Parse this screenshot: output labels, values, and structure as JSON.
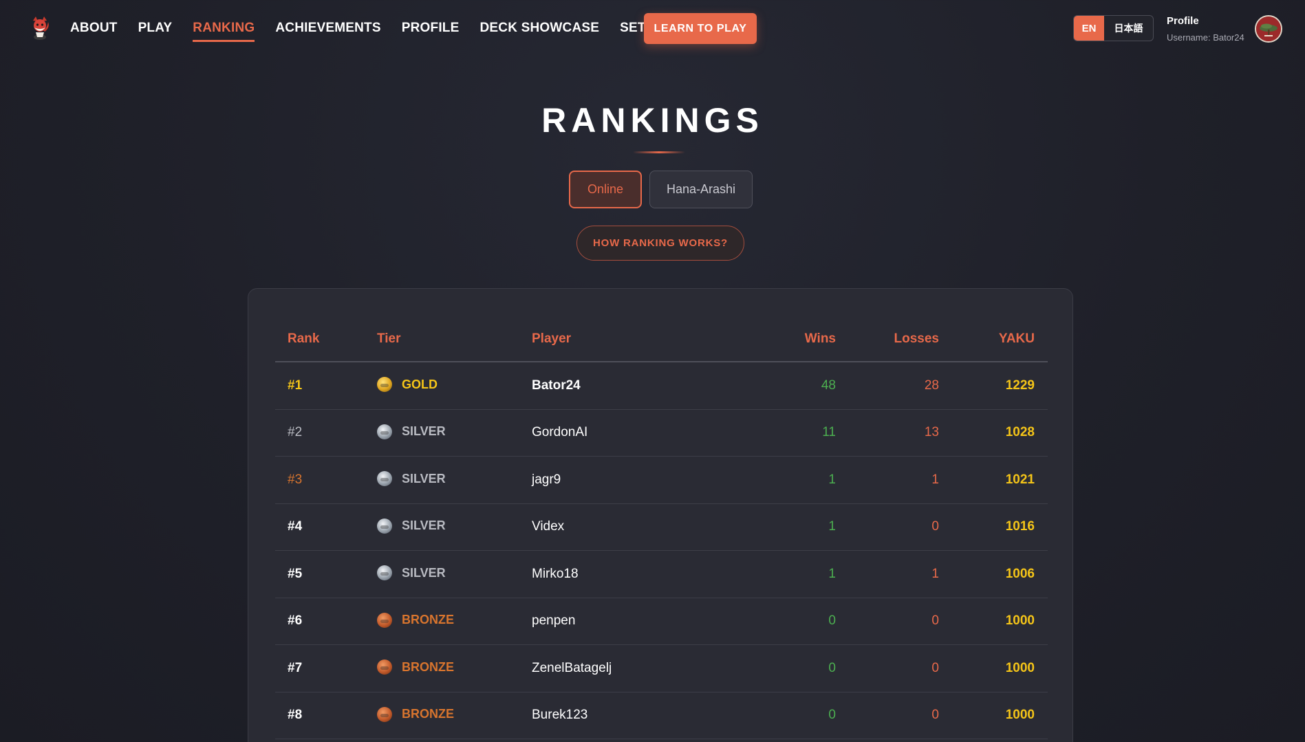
{
  "nav": {
    "links": [
      {
        "label": "ABOUT",
        "active": false
      },
      {
        "label": "PLAY",
        "active": false
      },
      {
        "label": "RANKING",
        "active": true
      },
      {
        "label": "ACHIEVEMENTS",
        "active": false
      },
      {
        "label": "PROFILE",
        "active": false
      },
      {
        "label": "DECK SHOWCASE",
        "active": false
      },
      {
        "label": "SETTINGS",
        "active": false
      }
    ],
    "cta_label": "LEARN TO PLAY",
    "lang_en": "EN",
    "lang_jp": "日本語",
    "profile_title": "Profile",
    "profile_username": "Username: Bator24"
  },
  "page": {
    "title": "RANKINGS",
    "tabs": [
      {
        "label": "Online",
        "selected": true
      },
      {
        "label": "Hana-Arashi",
        "selected": false
      }
    ],
    "how_label": "HOW RANKING WORKS?"
  },
  "table": {
    "headers": {
      "rank": "Rank",
      "tier": "Tier",
      "player": "Player",
      "wins": "Wins",
      "losses": "Losses",
      "yaku": "YAKU"
    },
    "rows": [
      {
        "rank": "#1",
        "tier": "GOLD",
        "player": "Bator24",
        "wins": "48",
        "losses": "28",
        "yaku": "1229"
      },
      {
        "rank": "#2",
        "tier": "SILVER",
        "player": "GordonAI",
        "wins": "11",
        "losses": "13",
        "yaku": "1028"
      },
      {
        "rank": "#3",
        "tier": "SILVER",
        "player": "jagr9",
        "wins": "1",
        "losses": "1",
        "yaku": "1021"
      },
      {
        "rank": "#4",
        "tier": "SILVER",
        "player": "Videx",
        "wins": "1",
        "losses": "0",
        "yaku": "1016"
      },
      {
        "rank": "#5",
        "tier": "SILVER",
        "player": "Mirko18",
        "wins": "1",
        "losses": "1",
        "yaku": "1006"
      },
      {
        "rank": "#6",
        "tier": "BRONZE",
        "player": "penpen",
        "wins": "0",
        "losses": "0",
        "yaku": "1000"
      },
      {
        "rank": "#7",
        "tier": "BRONZE",
        "player": "ZenelBatagelj",
        "wins": "0",
        "losses": "0",
        "yaku": "1000"
      },
      {
        "rank": "#8",
        "tier": "BRONZE",
        "player": "Burek123",
        "wins": "0",
        "losses": "0",
        "yaku": "1000"
      }
    ]
  },
  "colors": {
    "accent": "#e8694a",
    "gold": "#f5c518",
    "silver": "#b9bbc2",
    "bronze": "#d9752e",
    "wins": "#4caf50",
    "background": "#1f2029"
  },
  "icons": {
    "logo": "fox-mascot-icon",
    "avatar": "pine-tree-avatar-icon",
    "tier_gold": "gold-medal-icon",
    "tier_silver": "silver-medal-icon",
    "tier_bronze": "bronze-medal-icon"
  }
}
